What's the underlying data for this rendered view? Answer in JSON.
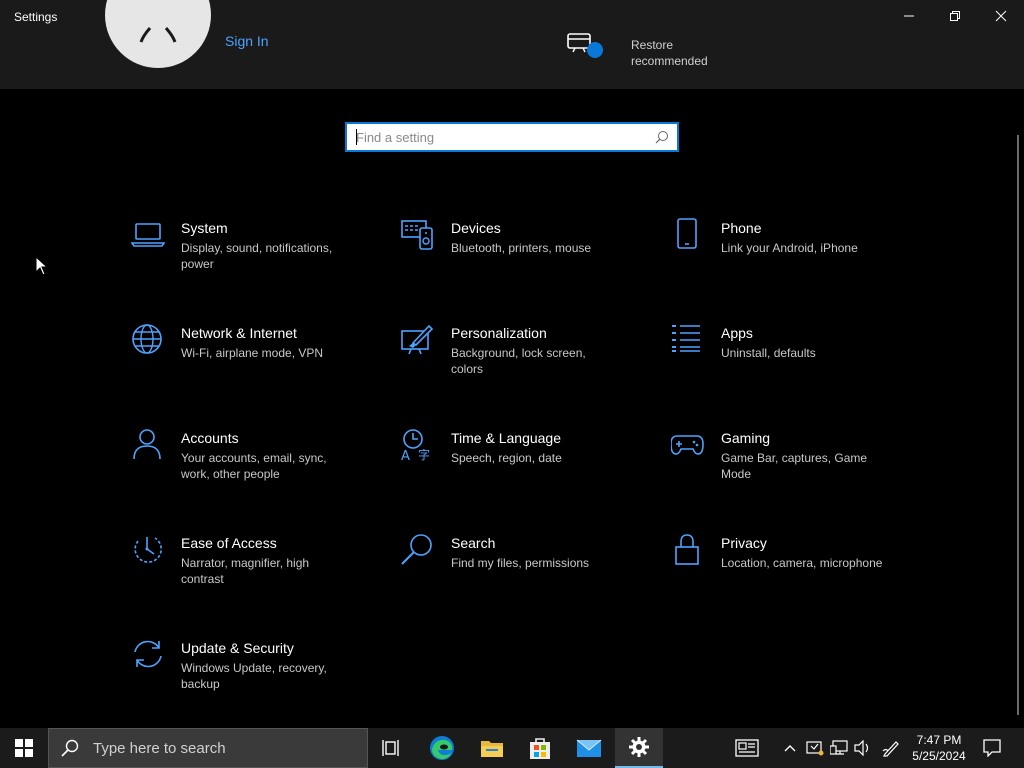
{
  "window": {
    "title": "Settings"
  },
  "header": {
    "sign_in": "Sign In",
    "restore_label": "Restore recommended"
  },
  "search": {
    "placeholder": "Find a setting",
    "value": ""
  },
  "categories": [
    {
      "title": "System",
      "desc": "Display, sound, notifications, power",
      "icon": "laptop-icon"
    },
    {
      "title": "Devices",
      "desc": "Bluetooth, printers, mouse",
      "icon": "devices-icon"
    },
    {
      "title": "Phone",
      "desc": "Link your Android, iPhone",
      "icon": "phone-icon"
    },
    {
      "title": "Network & Internet",
      "desc": "Wi-Fi, airplane mode, VPN",
      "icon": "globe-icon"
    },
    {
      "title": "Personalization",
      "desc": "Background, lock screen, colors",
      "icon": "paint-icon"
    },
    {
      "title": "Apps",
      "desc": "Uninstall, defaults",
      "icon": "apps-list-icon"
    },
    {
      "title": "Accounts",
      "desc": "Your accounts, email, sync, work, other people",
      "icon": "person-icon"
    },
    {
      "title": "Time & Language",
      "desc": "Speech, region, date",
      "icon": "time-language-icon"
    },
    {
      "title": "Gaming",
      "desc": "Game Bar, captures, Game Mode",
      "icon": "gamepad-icon"
    },
    {
      "title": "Ease of Access",
      "desc": "Narrator, magnifier, high contrast",
      "icon": "ease-of-access-icon"
    },
    {
      "title": "Search",
      "desc": "Find my files, permissions",
      "icon": "search-icon"
    },
    {
      "title": "Privacy",
      "desc": "Location, camera, microphone",
      "icon": "lock-icon"
    },
    {
      "title": "Update & Security",
      "desc": "Windows Update, recovery, backup",
      "icon": "sync-icon"
    }
  ],
  "taskbar": {
    "search_text": "Type here to search",
    "time": "7:47 PM",
    "date": "5/25/2024"
  },
  "colors": {
    "accent": "#0a78d7",
    "link": "#4ca3ff",
    "background": "#000000"
  }
}
